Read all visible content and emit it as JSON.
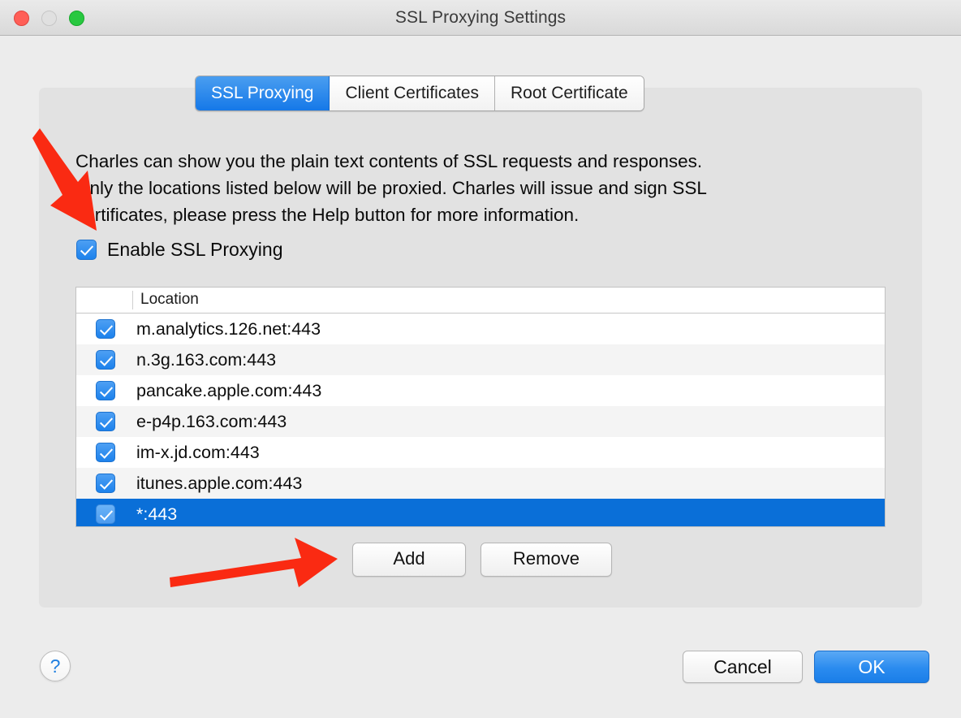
{
  "window": {
    "title": "SSL Proxying Settings",
    "traffic_lights": {
      "close": "close-button",
      "minimize": "minimize-button",
      "maximize": "maximize-button"
    }
  },
  "tabs": [
    {
      "label": "SSL Proxying",
      "active": true
    },
    {
      "label": "Client Certificates",
      "active": false
    },
    {
      "label": "Root Certificate",
      "active": false
    }
  ],
  "description": {
    "line1": "Charles can show you the plain text contents of SSL requests and responses.",
    "line2": "Only the locations listed below will be proxied. Charles will issue and sign SSL",
    "line3": "certificates, please press the Help button for more information."
  },
  "enable_checkbox": {
    "label": "Enable SSL Proxying",
    "checked": true
  },
  "table": {
    "columns": [
      "Location"
    ],
    "rows": [
      {
        "location": "m.analytics.126.net:443",
        "checked": true,
        "selected": false
      },
      {
        "location": "n.3g.163.com:443",
        "checked": true,
        "selected": false
      },
      {
        "location": "pancake.apple.com:443",
        "checked": true,
        "selected": false
      },
      {
        "location": "e-p4p.163.com:443",
        "checked": true,
        "selected": false
      },
      {
        "location": "im-x.jd.com:443",
        "checked": true,
        "selected": false
      },
      {
        "location": "itunes.apple.com:443",
        "checked": true,
        "selected": false
      },
      {
        "location": "*:443",
        "checked": true,
        "selected": true
      }
    ]
  },
  "list_buttons": {
    "add": "Add",
    "remove": "Remove"
  },
  "footer": {
    "help": "?",
    "cancel": "Cancel",
    "ok": "OK"
  },
  "annotations": {
    "arrow_color": "#fa2a12",
    "arrow_1": "points to Enable SSL Proxying checkbox",
    "arrow_2": "points to Add button"
  },
  "colors": {
    "accent_blue": "#1578e8",
    "selection_blue": "#0a6fd8",
    "window_bg": "#ececec",
    "panel_bg": "#e2e2e2"
  }
}
